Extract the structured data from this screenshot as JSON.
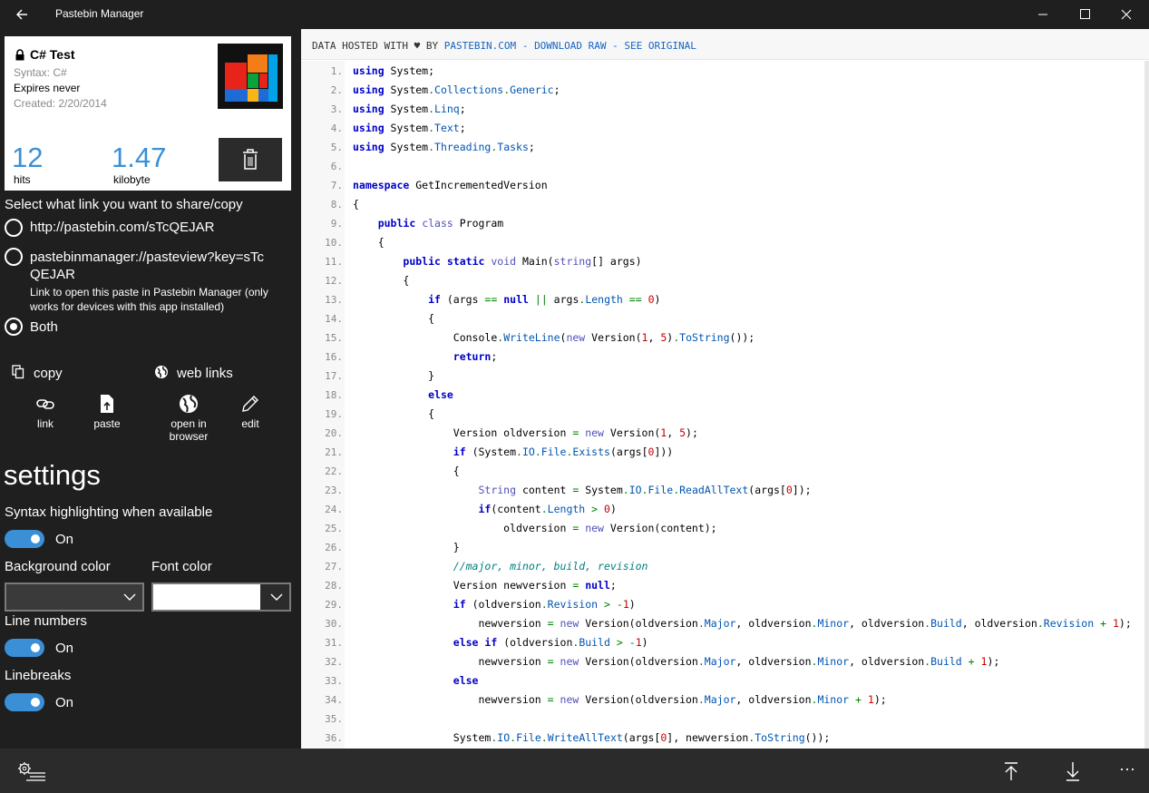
{
  "titlebar": {
    "title": "Pastebin Manager"
  },
  "paste": {
    "title": "C# Test",
    "syntax": "Syntax: C#",
    "expires": "Expires never",
    "created": "Created: 2/20/2014",
    "hits": "12",
    "hits_label": "hits",
    "size": "1.47",
    "size_label": "kilobyte"
  },
  "share": {
    "heading": "Select what link you want to share/copy",
    "options": [
      {
        "label": "http://pastebin.com/sTcQEJAR",
        "checked": false
      },
      {
        "label": "pastebinmanager://pasteview?key=sTcQEJAR",
        "description": "Link to open this paste in Pastebin Manager (only works for devices with this app installed)",
        "checked": false
      },
      {
        "label": "Both",
        "checked": true
      }
    ],
    "copy_label": "copy",
    "weblinks_label": "web links",
    "actions": {
      "link": "link",
      "paste": "paste",
      "open": "open in browser",
      "edit": "edit"
    }
  },
  "settings": {
    "heading": "settings",
    "syntax_label": "Syntax highlighting when available",
    "syntax_state": "On",
    "bg_label": "Background color",
    "font_label": "Font color",
    "bg_color": "#3a3a3a",
    "font_color": "#ffffff",
    "linenumbers_label": "Line numbers",
    "linenumbers_state": "On",
    "linebreaks_label": "Linebreaks",
    "linebreaks_state": "On"
  },
  "source": {
    "prefix": "DATA HOSTED WITH ♥ BY",
    "site": "PASTEBIN.COM",
    "sep1": "-",
    "raw": "DOWNLOAD RAW",
    "sep2": "-",
    "original": "SEE ORIGINAL"
  },
  "code": {
    "line_numbers": [
      "1.",
      "2.",
      "3.",
      "4.",
      "5.",
      "6.",
      "7.",
      "8.",
      "9.",
      "10.",
      "11.",
      "12.",
      "13.",
      "14.",
      "15.",
      "16.",
      "17.",
      "18.",
      "19.",
      "20.",
      "21.",
      "22.",
      "23.",
      "24.",
      "25.",
      "26.",
      "27.",
      "28.",
      "29.",
      "30.",
      "31.",
      "32.",
      "33.",
      "34.",
      "35.",
      "36."
    ],
    "lines": [
      "using System;",
      "using System.Collections.Generic;",
      "using System.Linq;",
      "using System.Text;",
      "using System.Threading.Tasks;",
      "",
      "namespace GetIncrementedVersion",
      "{",
      "    public class Program",
      "    {",
      "        public static void Main(string[] args)",
      "        {",
      "            if (args == null || args.Length == 0)",
      "            {",
      "                Console.WriteLine(new Version(1, 5).ToString());",
      "                return;",
      "            }",
      "            else",
      "            {",
      "                Version oldversion = new Version(1, 5);",
      "                if (System.IO.File.Exists(args[0]))",
      "                {",
      "                    String content = System.IO.File.ReadAllText(args[0]);",
      "                    if(content.Length > 0)",
      "                        oldversion = new Version(content);",
      "                }",
      "                //major, minor, build, revision",
      "                Version newversion = null;",
      "                if (oldversion.Revision > -1)",
      "                    newversion = new Version(oldversion.Major, oldversion.Minor, oldversion.Build, oldversion.Revision + 1);",
      "                else if (oldversion.Build > -1)",
      "                    newversion = new Version(oldversion.Major, oldversion.Minor, oldversion.Build + 1);",
      "                else",
      "                    newversion = new Version(oldversion.Major, oldversion.Minor + 1);",
      "",
      "                System.IO.File.WriteAllText(args[0], newversion.ToString());"
    ]
  },
  "bottom": {
    "more_label": "···"
  },
  "colors": {
    "accent": "#3a8fd6",
    "window_bg": "#1f1f1f",
    "command_bar": "#2b2b2b"
  }
}
